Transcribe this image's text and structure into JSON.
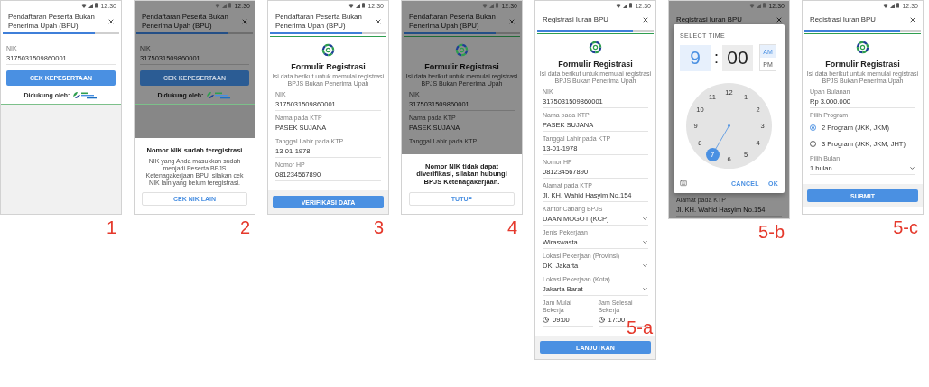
{
  "screens": [
    {
      "kind": "nik_check",
      "step": "1",
      "time": "12:30",
      "title": "Pendaftaran Peserta Bukan Penerima Upah (BPU)",
      "progress": {
        "level": 0.79
      },
      "dimmed": false,
      "fields": [
        {
          "kind": "text",
          "label": "NIK",
          "value": "3175031509860001"
        }
      ],
      "button": "CEK KEPESERTAAN",
      "support": "Didukung oleh:"
    },
    {
      "kind": "nik_check",
      "step": "2",
      "time": "12:30",
      "title": "Pendaftaran Peserta Bukan Penerima Upah (BPU)",
      "progress": {
        "level": 0.79
      },
      "dimmed": true,
      "fields": [
        {
          "kind": "text",
          "label": "NIK",
          "value": "3175031509860001"
        }
      ],
      "button": "CEK KEPESERTAAN",
      "support": "Didukung oleh:",
      "sheet": {
        "title": "Nomor NIK sudah teregistrasi",
        "message": "NIK yang Anda masukkan sudah menjadi Peserta BPJS Ketenagakerjaan BPU, silakan cek NIK lain yang belum teregistrasi.",
        "button": "CEK NIK LAIN"
      }
    },
    {
      "kind": "form",
      "step": "3",
      "time": "12:30",
      "title": "Pendaftaran Peserta Bukan Penerima Upah (BPU)",
      "progress": {
        "level": 0.79
      },
      "dimmed": false,
      "form_title": "Formulir Registrasi",
      "form_subtitle": "Isi data berikut untuk memulai registrasi BPJS Bukan Penerima Upah",
      "fields": [
        {
          "kind": "text",
          "label": "NIK",
          "value": "3175031509860001"
        },
        {
          "kind": "text",
          "label": "Nama pada KTP",
          "value": "PASEK SUJANA"
        },
        {
          "kind": "text",
          "label": "Tanggal Lahir pada KTP",
          "value": "13-01-1978"
        },
        {
          "kind": "text",
          "label": "Nomor HP",
          "value": "081234567890"
        }
      ],
      "button": "VERIFIKASI DATA"
    },
    {
      "kind": "form",
      "step": "4",
      "time": "12:30",
      "title": "Pendaftaran Peserta Bukan Penerima Upah (BPU)",
      "progress": {
        "level": 0.79
      },
      "dimmed": true,
      "form_title": "Formulir Registrasi",
      "form_subtitle": "Isi data berikut untuk memulai registrasi BPJS Bukan Penerima Upah",
      "fields": [
        {
          "kind": "text",
          "label": "NIK",
          "value": "3175031509860001"
        },
        {
          "kind": "text",
          "label": "Nama pada KTP",
          "value": "PASEK SUJANA"
        },
        {
          "kind": "text",
          "label": "Tanggal Lahir pada KTP"
        }
      ],
      "sheet": {
        "title": "Nomor NIK tidak dapat diverifikasi, silakan hubungi BPJS Ketenagakerjaan.",
        "button": "TUTUP"
      }
    },
    {
      "kind": "form",
      "step": "5-a",
      "time": "12:30",
      "title": "Registrasi Iuran BPU",
      "progress": {
        "level": 0.82
      },
      "dimmed": false,
      "form_title": "Formulir Registrasi",
      "form_subtitle": "Isi data berikut untuk memulai registrasi BPJS Bukan Penerima Upah",
      "fields": [
        {
          "kind": "text",
          "label": "NIK",
          "value": "3175031509860001"
        },
        {
          "kind": "text",
          "label": "Nama pada KTP",
          "value": "PASEK SUJANA"
        },
        {
          "kind": "text",
          "label": "Tanggal Lahir pada KTP",
          "value": "13-01-1978"
        },
        {
          "kind": "text",
          "label": "Nomor HP",
          "value": "081234567890"
        },
        {
          "kind": "text",
          "label": "Alamat pada KTP",
          "value": "Jl. KH. Wahid Hasyim No.154"
        },
        {
          "kind": "select",
          "label": "Kantor Cabang BPJS",
          "value": "DAAN MOGOT (KCP)"
        },
        {
          "kind": "select",
          "label": "Jenis Pekerjaan",
          "value": "Wiraswasta"
        },
        {
          "kind": "select",
          "label": "Lokasi Pekerjaan (Provinsi)",
          "value": "DKI Jakarta"
        },
        {
          "kind": "select",
          "label": "Lokasi Pekerjaan (Kota)",
          "value": "Jakarta Barat"
        },
        {
          "kind": "time_pair",
          "items": [
            {
              "label": "Jam Mulai Bekerja",
              "value": "09:00"
            },
            {
              "label": "Jam Selesai Bekerja",
              "value": "17:00"
            }
          ]
        }
      ],
      "button": "LANJUTKAN"
    },
    {
      "kind": "time_picker",
      "step": "5-b",
      "time": "12:30",
      "title": "Registrasi Iuran BPU",
      "dimmed": true,
      "picker": {
        "heading": "SELECT TIME",
        "hour": "9",
        "separator": ":",
        "minute": "00",
        "periods": [
          {
            "label": "AM",
            "selected": true
          },
          {
            "label": "PM",
            "selected": false
          }
        ],
        "numbers": [
          {
            "label": "12",
            "selected": false
          },
          {
            "label": "1",
            "selected": false
          },
          {
            "label": "2",
            "selected": false
          },
          {
            "label": "3",
            "selected": false
          },
          {
            "label": "4",
            "selected": false
          },
          {
            "label": "5",
            "selected": false
          },
          {
            "label": "6",
            "selected": false
          },
          {
            "label": "7",
            "selected": true
          },
          {
            "label": "8",
            "selected": false
          },
          {
            "label": "9",
            "selected": false
          },
          {
            "label": "10",
            "selected": false
          },
          {
            "label": "11",
            "selected": false
          }
        ],
        "cancel": "CANCEL",
        "ok": "OK"
      },
      "fields": [
        {
          "kind": "text",
          "label": "Alamat pada KTP",
          "value": "Jl. KH. Wahid Hasyim No.154"
        }
      ]
    },
    {
      "kind": "form",
      "step": "5-c",
      "time": "12:30",
      "title": "Registrasi Iuran BPU",
      "progress": {
        "level": 0.82
      },
      "dimmed": false,
      "form_title": "Formulir Registrasi",
      "form_subtitle": "Isi data berikut untuk memulai registrasi BPJS Bukan Penerima Upah",
      "fields": [
        {
          "kind": "text",
          "label": "Upah Bulanan",
          "value": "Rp 3.000.000"
        },
        {
          "kind": "radio",
          "label": "Pilih Program",
          "options": [
            {
              "label": "2 Program (JKK, JKM)",
              "selected": true
            },
            {
              "label": "3 Program (JKK, JKM, JHT)",
              "selected": false
            }
          ]
        },
        {
          "kind": "select",
          "label": "Pilih Bulan",
          "value": "1 bulan"
        }
      ],
      "button": "SUBMIT"
    }
  ]
}
